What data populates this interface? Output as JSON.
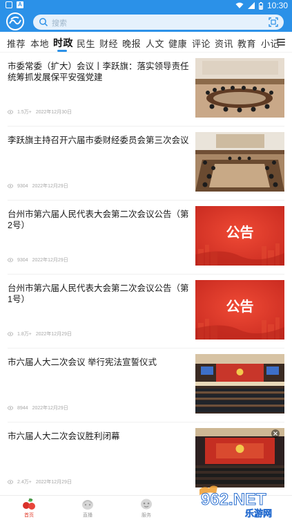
{
  "status_bar": {
    "time": "10:30",
    "badge": "A"
  },
  "search": {
    "placeholder": "搜索"
  },
  "tabs": [
    {
      "label": "推荐"
    },
    {
      "label": "本地"
    },
    {
      "label": "时政"
    },
    {
      "label": "民生"
    },
    {
      "label": "财经"
    },
    {
      "label": "晚报"
    },
    {
      "label": "人文"
    },
    {
      "label": "健康"
    },
    {
      "label": "评论"
    },
    {
      "label": "资讯"
    },
    {
      "label": "教育"
    },
    {
      "label": "小记"
    }
  ],
  "active_tab": "时政",
  "news": [
    {
      "title": "市委常委（扩大）会议丨李跃旗：落实领导责任 统筹抓发展保平安强党建",
      "views": "1.5万+",
      "date": "2022年12月30日",
      "thumb": "meeting"
    },
    {
      "title": "李跃旗主持召开六届市委财经委员会第三次会议",
      "views": "9304",
      "date": "2022年12月29日",
      "thumb": "meeting"
    },
    {
      "title": "台州市第六届人民代表大会第二次会议公告（第2号）",
      "views": "9304",
      "date": "2022年12月29日",
      "thumb": "notice",
      "thumb_text": "公告"
    },
    {
      "title": "台州市第六届人民代表大会第二次会议公告（第1号）",
      "views": "1.8万+",
      "date": "2022年12月29日",
      "thumb": "notice",
      "thumb_text": "公告"
    },
    {
      "title": "市六届人大二次会议 举行宪法宣誓仪式",
      "views": "8944",
      "date": "2022年12月29日",
      "thumb": "hall"
    },
    {
      "title": "市六届人大二次会议胜利闭幕",
      "views": "2.4万+",
      "date": "2022年12月29日",
      "thumb": "hall_red"
    }
  ],
  "bottom_nav": [
    {
      "label": "首页",
      "icon": "home-cherry-icon",
      "active": true
    },
    {
      "label": "直播",
      "icon": "live-icon",
      "active": false
    },
    {
      "label": "服务",
      "icon": "service-icon",
      "active": false
    }
  ],
  "watermark": {
    "text": "962.NET",
    "subtext": "乐游网"
  },
  "colors": {
    "brand_blue": "#2b91e8",
    "notice_red": "#d8322a",
    "active_red": "#e23b2a"
  }
}
